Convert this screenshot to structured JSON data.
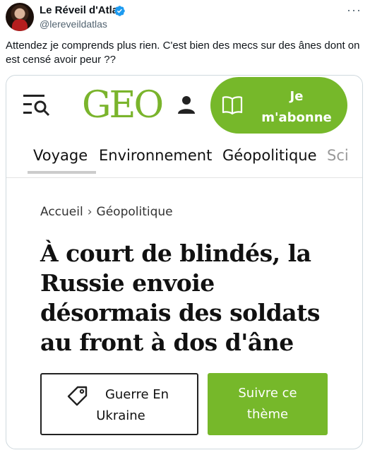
{
  "tweet": {
    "author_name": "Le Réveil d'Atlas",
    "handle": "@lereveildatlas",
    "text": "Attendez je comprends plus rien. C'est bien des mecs sur des ânes dont on est censé avoir peur ??",
    "more_icon": "ellipsis-icon"
  },
  "geo": {
    "logo": "GEO",
    "subscribe_label": "Je\nm'abonne",
    "brand_color": "#76b82a",
    "nav": [
      {
        "label": "Voyage",
        "active": true
      },
      {
        "label": "Environnement"
      },
      {
        "label": "Géopolitique"
      },
      {
        "label": "Sci"
      }
    ],
    "breadcrumb": [
      "Accueil",
      "Géopolitique"
    ],
    "headline": "À court de blindés, la Russie envoie désormais des soldats au front à dos d'âne",
    "tag_label_line1": "Guerre En",
    "tag_label_line2": "Ukraine",
    "follow_label": "Suivre ce\nthème"
  },
  "colors": {
    "verified_blue": "#1d9bf0",
    "secondary_text": "#536471"
  }
}
